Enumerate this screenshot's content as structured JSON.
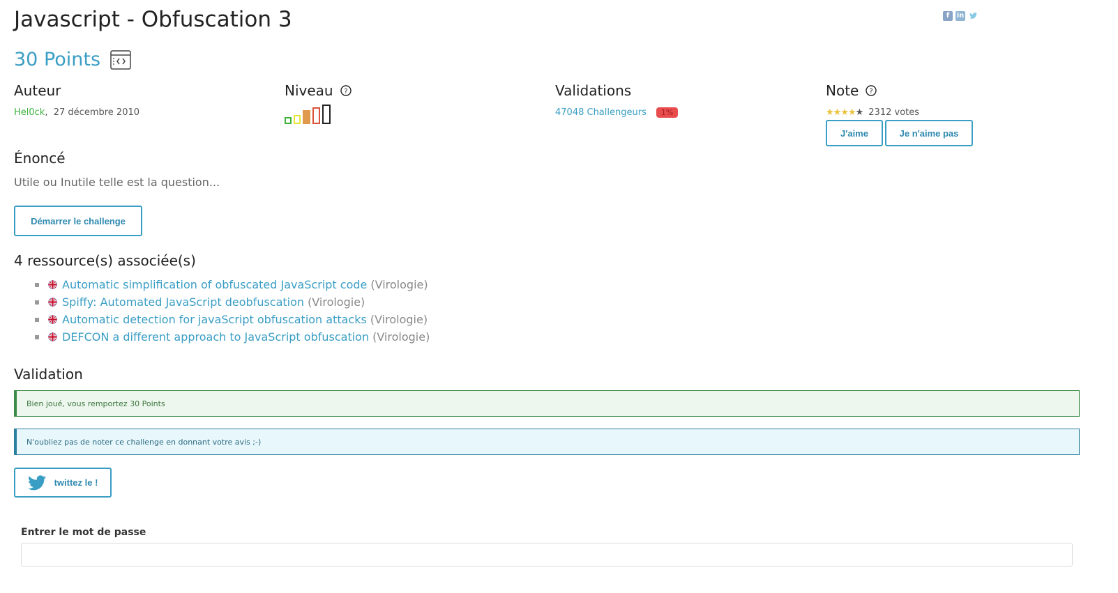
{
  "social": {
    "facebook": "f",
    "linkedin": "in",
    "twitter": "t"
  },
  "title": "Javascript - Obfuscation 3",
  "points": {
    "label": "30 Points"
  },
  "author": {
    "heading": "Auteur",
    "name": "Hel0ck",
    "sep": ",",
    "date": "27 décembre 2010"
  },
  "level": {
    "heading": "Niveau",
    "current": 4,
    "max": 5,
    "colors": [
      "#3db13d",
      "#e6e63a",
      "#e09a4e",
      "#d9533d",
      "#222222"
    ]
  },
  "validations": {
    "heading": "Validations",
    "count": "47048 Challengeurs",
    "percent": "1%"
  },
  "rating": {
    "heading": "Note",
    "stars": 4,
    "max_stars": 5,
    "votes": "2312 votes",
    "like": "J'aime",
    "dislike": "Je n'aime pas"
  },
  "statement": {
    "heading": "Énoncé",
    "text": "Utile ou Inutile telle est la question..."
  },
  "start_button": "Démarrer le challenge",
  "resources": {
    "heading": "4 ressource(s) associée(s)",
    "items": [
      {
        "title": "Automatic simplification of obfuscated JavaScript code",
        "category": "(Virologie)"
      },
      {
        "title": "Spiffy: Automated JavaScript deobfuscation",
        "category": "(Virologie)"
      },
      {
        "title": "Automatic detection for javaScript obfuscation attacks",
        "category": "(Virologie)"
      },
      {
        "title": "DEFCON a different approach to JavaScript obfuscation",
        "category": "(Virologie)"
      }
    ]
  },
  "validation": {
    "heading": "Validation",
    "success": "Bien joué, vous remportez 30 Points",
    "info": "N'oubliez pas de noter ce challenge en donnant votre avis ;-)",
    "tweet": "twittez le !"
  },
  "password": {
    "label": "Entrer le mot de passe",
    "value": ""
  },
  "colors": {
    "accent": "#3a9ec4",
    "success": "#3c8a48",
    "info": "#2b7fa0",
    "badge": "#e84c4c",
    "star": "#e8c23a"
  }
}
